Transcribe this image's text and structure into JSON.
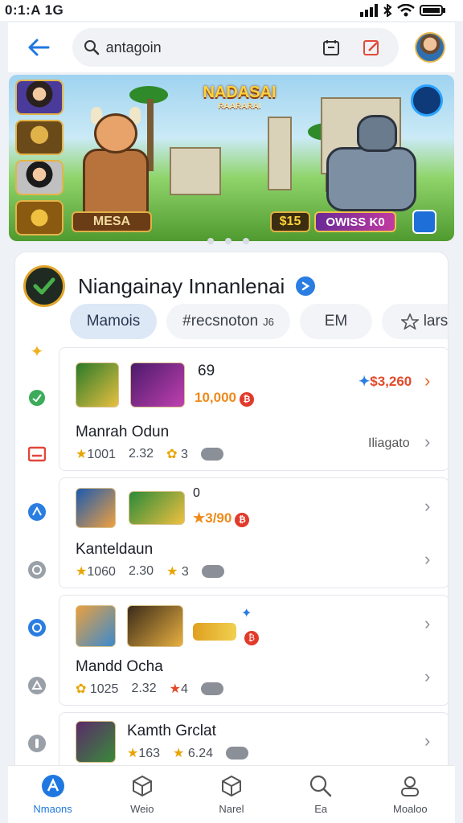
{
  "status_bar": {
    "time": "0:1:A 1G"
  },
  "header": {
    "search_text": "antagoin"
  },
  "banner": {
    "title": "NADASAI",
    "subtitle": "RAARARAI",
    "left_button": "MESA",
    "badge": "$15",
    "offer": "OWISS K0"
  },
  "app": {
    "name": "Niangainay Innanlenai",
    "tabs": [
      "Mamois",
      "#recsnoton",
      "EM",
      "lars"
    ],
    "tab_extra": "J6"
  },
  "items": [
    {
      "title": "Manrah Odun",
      "count": "69",
      "score": "10,000",
      "price": "$3,260",
      "right_label": "Iliagato",
      "stats": [
        "1001",
        "2.32",
        "3"
      ]
    },
    {
      "title": "Kanteldaun",
      "count": "0",
      "score": "",
      "price": "3/90",
      "right_label": "",
      "stats": [
        "1060",
        "2.30",
        "3"
      ]
    },
    {
      "title": "Mandd Ocha",
      "count": "",
      "score": "",
      "price": "",
      "right_label": "",
      "stats": [
        "1025",
        "2.32",
        "4"
      ]
    },
    {
      "title": "Kamth Grclat",
      "count": "",
      "score": "",
      "price": "",
      "right_label": "",
      "stats": [
        "163",
        "6.24",
        ""
      ]
    }
  ],
  "bottom_nav": [
    "Nmaons",
    "Weio",
    "Narel",
    "Ea",
    "Moaloo"
  ],
  "colors": {
    "accent": "#1f78e0",
    "price": "#e24a2a",
    "star": "#e8a400"
  }
}
